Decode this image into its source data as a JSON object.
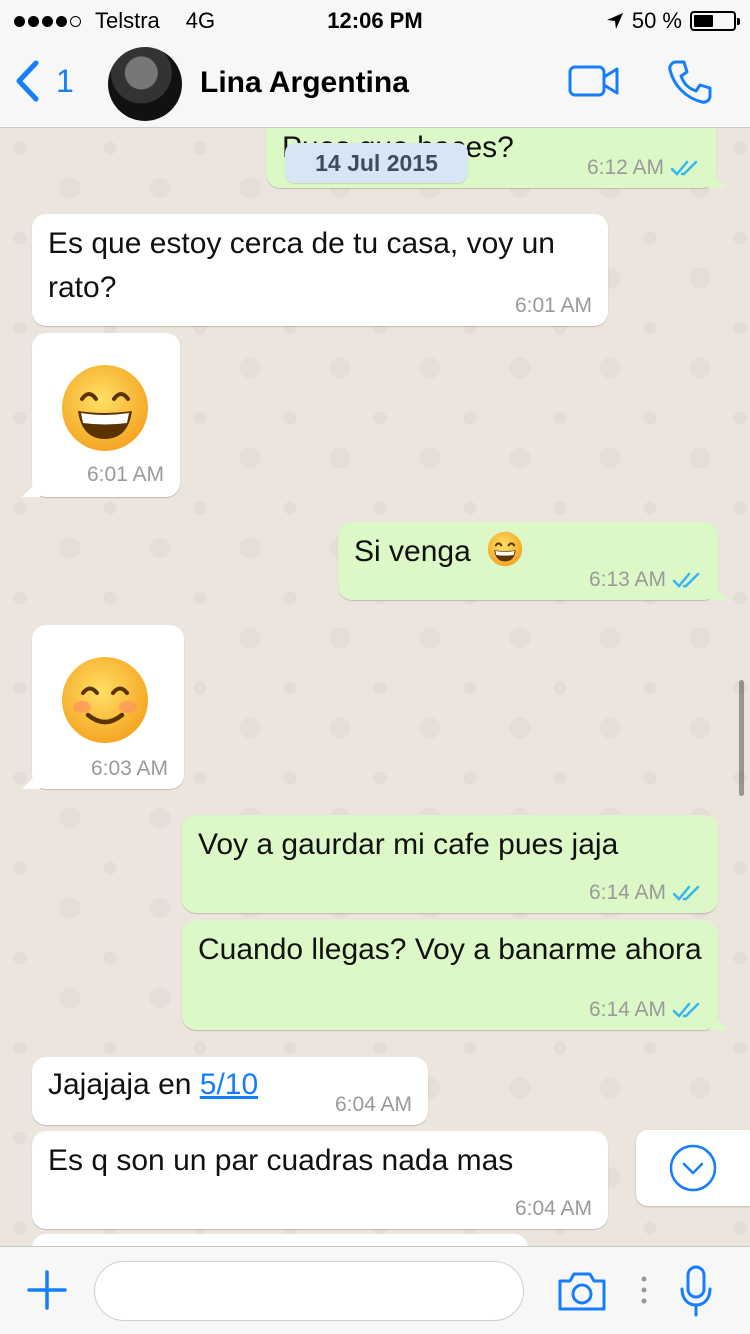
{
  "status_bar": {
    "carrier": "Telstra",
    "network": "4G",
    "time": "12:06 PM",
    "battery": "50 %",
    "battery_level": 0.5,
    "signal_bars": 4
  },
  "header": {
    "back_count": "1",
    "contact_name": "Lina Argentina"
  },
  "date_label": "14 Jul 2015",
  "messages": [
    {
      "direction": "out",
      "text": "Pues que haces?",
      "time": "6:12 AM",
      "read": true
    },
    {
      "direction": "in",
      "text": "Es que estoy cerca de tu casa, voy un rato?",
      "time": "6:01 AM"
    },
    {
      "direction": "in",
      "emoji": "grinning-face-with-smiling-eyes",
      "time": "6:01 AM"
    },
    {
      "direction": "out",
      "text": "Si venga",
      "emoji": "grinning-face-with-smiling-eyes",
      "time": "6:13 AM",
      "read": true
    },
    {
      "direction": "in",
      "emoji": "smiling-face-with-smiling-eyes",
      "time": "6:03 AM"
    },
    {
      "direction": "out",
      "text": "Voy a gaurdar mi cafe pues jaja",
      "time": "6:14 AM",
      "read": true
    },
    {
      "direction": "out",
      "text": "Cuando llegas? Voy a banarme ahora",
      "time": "6:14 AM",
      "read": true
    },
    {
      "direction": "in",
      "text": "Jajajaja en ",
      "link": "5/10",
      "time": "6:04 AM"
    },
    {
      "direction": "in",
      "text": "Es q son un par cuadras nada mas",
      "time": "6:04 AM"
    }
  ],
  "input": {
    "placeholder": ""
  },
  "colors": {
    "accent": "#147efb",
    "outgoing_bubble": "#dcf8c6",
    "incoming_bubble": "#ffffff",
    "chat_background": "#ece5dd",
    "read_ticks": "#34b7f1"
  }
}
